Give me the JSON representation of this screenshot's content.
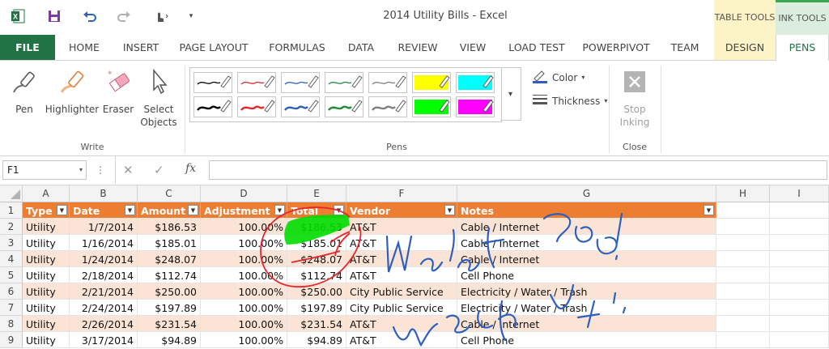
{
  "app": {
    "title": "2014 Utility Bills - Excel",
    "contextual_tabs": {
      "table_tools": "TABLE TOOLS",
      "ink_tools": "INK TOOLS"
    }
  },
  "quick_access": [
    "excel-logo-icon",
    "save-icon",
    "undo-icon",
    "redo-icon",
    "touch-mode-icon",
    "customize-qat-icon"
  ],
  "tabs": [
    "FILE",
    "HOME",
    "INSERT",
    "PAGE LAYOUT",
    "FORMULAS",
    "DATA",
    "REVIEW",
    "VIEW",
    "LOAD TEST",
    "POWERPIVOT",
    "TEAM",
    "DESIGN",
    "PENS"
  ],
  "active_tab": "PENS",
  "ribbon": {
    "write_group": {
      "label": "Write",
      "pen": "Pen",
      "highlighter": "Highlighter",
      "eraser": "Eraser",
      "select1": "Select",
      "select2": "Objects"
    },
    "pens_group": {
      "label": "Pens",
      "pens": [
        {
          "color": "#000000",
          "kind": "pen"
        },
        {
          "color": "#e8262b",
          "kind": "pen"
        },
        {
          "color": "#2e5fbe",
          "kind": "pen"
        },
        {
          "color": "#1e8a3a",
          "kind": "pen"
        },
        {
          "color": "#7f7f7f",
          "kind": "pen"
        },
        {
          "color": "#ffff00",
          "kind": "highlighter"
        },
        {
          "color": "#00ffff",
          "kind": "highlighter"
        },
        {
          "color": "#000000",
          "kind": "pen"
        },
        {
          "color": "#e8262b",
          "kind": "pen"
        },
        {
          "color": "#2e5fbe",
          "kind": "pen"
        },
        {
          "color": "#1e8a3a",
          "kind": "pen"
        },
        {
          "color": "#7f7f7f",
          "kind": "pen"
        },
        {
          "color": "#00ff00",
          "kind": "highlighter"
        },
        {
          "color": "#ff00ff",
          "kind": "highlighter"
        }
      ],
      "color": "Color",
      "thickness": "Thickness"
    },
    "close_group": {
      "label": "Close",
      "stop1": "Stop",
      "stop2": "Inking"
    }
  },
  "formula_bar": {
    "name_box": "F1",
    "value": ""
  },
  "columns": [
    "A",
    "B",
    "C",
    "D",
    "E",
    "F",
    "G",
    "H",
    "I"
  ],
  "table": {
    "headers": [
      "Type",
      "Date",
      "Amount",
      "Adjustment",
      "Total",
      "Vendor",
      "Notes"
    ],
    "rows": [
      {
        "num": "2",
        "cells": [
          "Utility",
          "1/7/2014",
          "$186.53",
          "100.00%",
          "$186.53",
          "AT&T",
          "Cable / Internet"
        ]
      },
      {
        "num": "3",
        "cells": [
          "Utility",
          "1/16/2014",
          "$185.01",
          "100.00%",
          "$185.01",
          "AT&T",
          "Cable / Internet"
        ]
      },
      {
        "num": "4",
        "cells": [
          "Utility",
          "1/24/2014",
          "$248.07",
          "100.00%",
          "$248.07",
          "AT&T",
          "Cable / Internet"
        ]
      },
      {
        "num": "5",
        "cells": [
          "Utility",
          "2/18/2014",
          "$112.74",
          "100.00%",
          "$112.74",
          "AT&T",
          "Cell Phone"
        ]
      },
      {
        "num": "6",
        "cells": [
          "Utility",
          "2/21/2014",
          "$250.00",
          "100.00%",
          "$250.00",
          "City Public Service",
          "Electricity / Water / Trash"
        ]
      },
      {
        "num": "7",
        "cells": [
          "Utility",
          "2/24/2014",
          "$197.89",
          "100.00%",
          "$197.89",
          "City Public Service",
          "Electricity / Water / Trash"
        ]
      },
      {
        "num": "8",
        "cells": [
          "Utility",
          "2/26/2014",
          "$231.54",
          "100.00%",
          "$231.54",
          "AT&T",
          "Cable / Internet"
        ]
      },
      {
        "num": "9",
        "cells": [
          "Utility",
          "3/17/2014",
          "$94.89",
          "100.00%",
          "$94.89",
          "AT&T",
          "Cell Phone"
        ]
      }
    ]
  },
  "colors": {
    "accent": "#217346",
    "table_header": "#ed7d31",
    "band": "#fbe4d5",
    "ink_red": "#e8262b",
    "ink_blue": "#2e5fbe",
    "ink_green": "#00dd00"
  }
}
